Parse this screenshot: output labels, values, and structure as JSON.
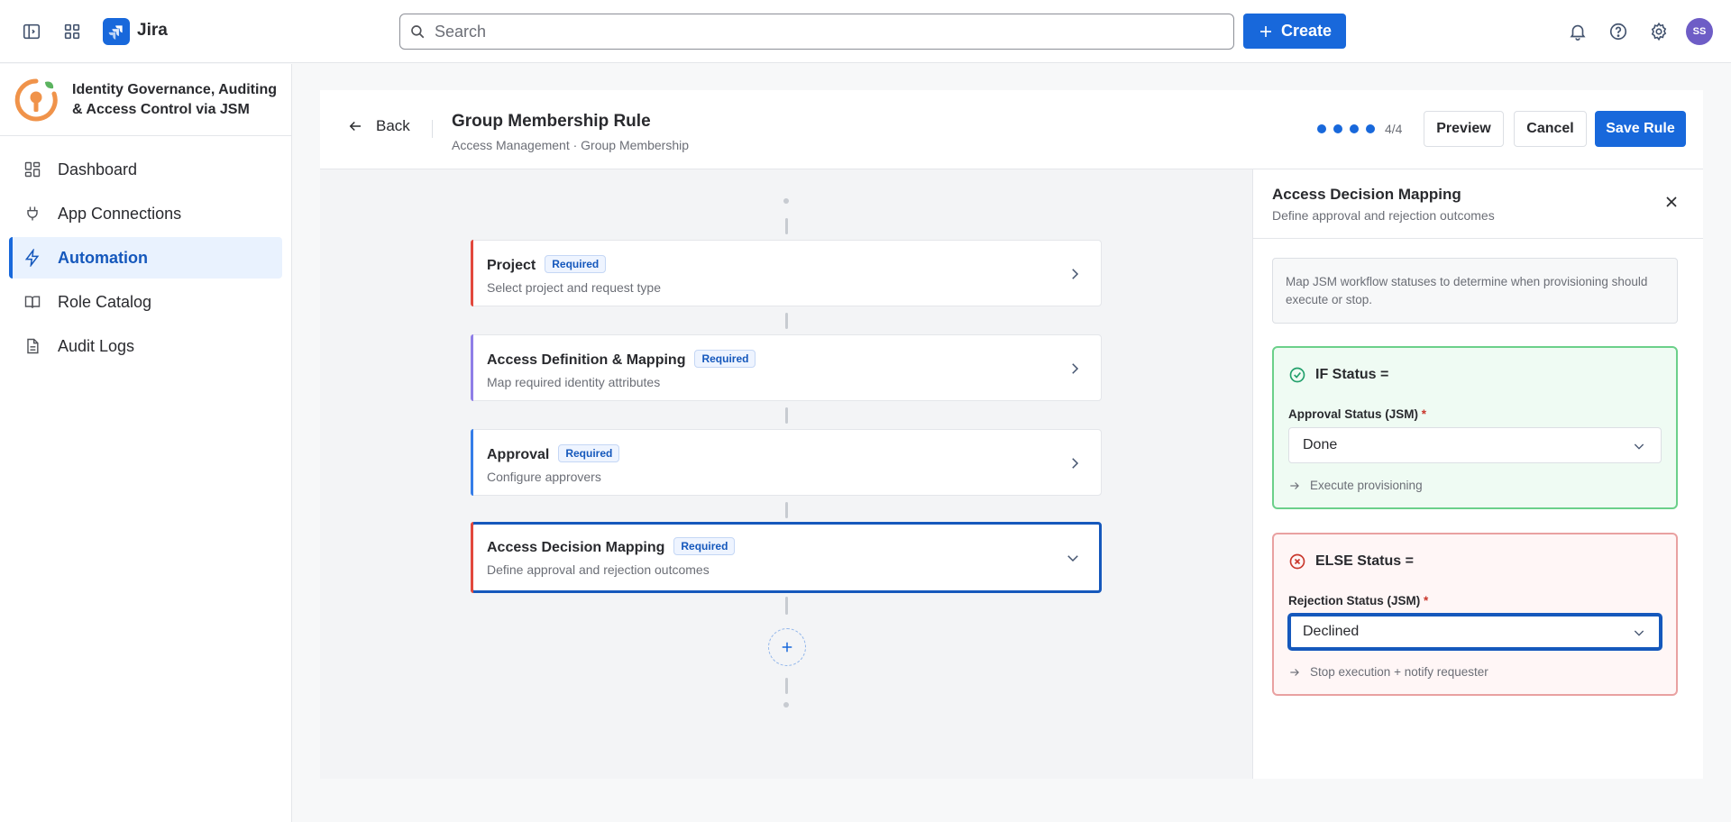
{
  "topnav": {
    "app_name": "Jira",
    "search_placeholder": "Search",
    "create_label": "Create",
    "avatar_initials": "SS"
  },
  "sidebar": {
    "app_title": "Identity Governance, Auditing & Access Control via JSM",
    "items": [
      {
        "label": "Dashboard",
        "icon": "dashboard-icon",
        "active": false
      },
      {
        "label": "App Connections",
        "icon": "plug-icon",
        "active": false
      },
      {
        "label": "Automation",
        "icon": "lightning-icon",
        "active": true
      },
      {
        "label": "Role Catalog",
        "icon": "book-icon",
        "active": false
      },
      {
        "label": "Audit Logs",
        "icon": "document-icon",
        "active": false
      }
    ]
  },
  "rule": {
    "back_label": "Back",
    "title": "Group Membership Rule",
    "breadcrumb": "Access Management · Group Membership",
    "step_count": "4/4",
    "preview_label": "Preview",
    "cancel_label": "Cancel",
    "save_label": "Save Rule"
  },
  "steps": [
    {
      "title": "Project",
      "badge": "Required",
      "subtitle": "Select project and request type",
      "accent": "#e2483d"
    },
    {
      "title": "Access Definition & Mapping",
      "badge": "Required",
      "subtitle": "Map required identity attributes",
      "accent": "#8f7ee7"
    },
    {
      "title": "Approval",
      "badge": "Required",
      "subtitle": "Configure approvers",
      "accent": "#357de8"
    },
    {
      "title": "Access Decision Mapping",
      "badge": "Required",
      "subtitle": "Define approval and rejection outcomes",
      "accent": "#e2483d"
    }
  ],
  "panel": {
    "title": "Access Decision Mapping",
    "subtitle": "Define approval and rejection outcomes",
    "info": "Map JSM workflow statuses to determine when provisioning should execute or stop.",
    "if_block": {
      "heading": "IF Status =",
      "label": "Approval Status (JSM)",
      "required_mark": "*",
      "value": "Done",
      "outcome": "Execute provisioning"
    },
    "else_block": {
      "heading": "ELSE Status =",
      "label": "Rejection Status (JSM)",
      "required_mark": "*",
      "value": "Declined",
      "outcome": "Stop execution + notify requester"
    }
  },
  "colors": {
    "brand": "#1868db",
    "if_border": "#6bd08a",
    "else_border": "#e9a1a1"
  }
}
